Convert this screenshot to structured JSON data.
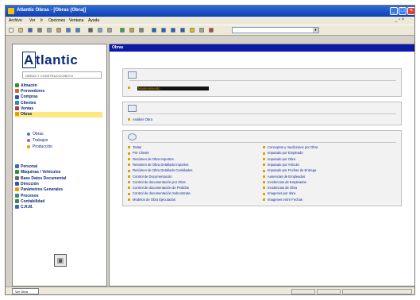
{
  "window": {
    "title": "Atlantic Obras - [Obras (Obra)]",
    "minimize_glyph": "_",
    "maximize_glyph": "□",
    "close_glyph": "×"
  },
  "menubar": {
    "items": [
      "Archivo",
      "Ver",
      "Ir",
      "Opciones",
      "Ventana",
      "Ayuda"
    ],
    "child_controls": "_ ▫ ×"
  },
  "toolbar": {
    "icons": [
      "new-doc-icon",
      "open-icon",
      "save-icon",
      "cut-icon",
      "copy-icon",
      "paste-icon",
      "undo-icon",
      "redo-icon",
      "print-icon",
      "preview-icon",
      "find-icon",
      "refresh-icon",
      "filter-icon",
      "sort-icon",
      "first-icon",
      "prev-icon",
      "next-icon",
      "last-icon",
      "help-icon",
      "zoom-icon",
      "exit-icon"
    ],
    "combo_value": "",
    "combo_arrow": "▼"
  },
  "sidebar": {
    "logo": "tlantic",
    "logo_initial": "A",
    "company_select": "OBRAS Y CONSTRUCCIONES ▾",
    "items_top": [
      {
        "label": "Almacén",
        "color": "#3a8a3a"
      },
      {
        "label": "Proveedores",
        "color": "#c07020"
      },
      {
        "label": "Compras",
        "color": "#2a5ab0"
      },
      {
        "label": "Clientes",
        "color": "#2a8ab0"
      },
      {
        "label": "Ventas",
        "color": "#b03a3a"
      },
      {
        "label": "Obras",
        "color": "#e0a000",
        "active": true
      }
    ],
    "sub_items": [
      {
        "label": "Obras",
        "color": "#4a7ad0"
      },
      {
        "label": "Trabajos",
        "color": "#c04ab0"
      },
      {
        "label": "Producción",
        "color": "#e0a000"
      }
    ],
    "items_bottom": [
      {
        "label": "Personal",
        "color": "#3a6ab0"
      },
      {
        "label": "Máquinas / Vehículos",
        "color": "#3a8a3a"
      },
      {
        "label": "Base Datos Documental",
        "color": "#6a6a6a"
      },
      {
        "label": "Dirección",
        "color": "#2a5ab0"
      },
      {
        "label": "Parámetros Generales",
        "color": "#e0a000"
      },
      {
        "label": "Procesos",
        "color": "#3a8a8a"
      },
      {
        "label": "Contabilidad",
        "color": "#3a8a3a"
      },
      {
        "label": "C.R.M.",
        "color": "#3a6ab0"
      }
    ],
    "bottom_logo_glyph": "▣"
  },
  "main": {
    "header": "Obras",
    "panel1": {
      "field_value": "Mantenimiento"
    },
    "panel2": {
      "link": "Análisis Obra"
    },
    "panel3": {
      "left_links": [
        "Todas",
        "Por Cliente",
        "Resúmen de Obra  Importes",
        "Resúmen de Obra Detallado  Importes",
        "Resúmen de Obra Detallado  Cantidades",
        "Control de Documentación",
        "Control de documentación por Obra",
        "Control de documentación de Pedidos",
        "Control de documentación Subcontrata",
        "Modelos de Obra Ejecutados"
      ],
      "right_links": [
        "Conceptos y mediciones por Obra",
        "Imputado por Empleado",
        "Imputado por Obra",
        "Imputado por Artículo",
        "Imputado por Fechas de Entrega",
        "Ausencias de Empleados",
        "Incidencias de Empleados",
        "Incidencias de Obra",
        "Imagenes por obra",
        "Imagenes entre Fechas"
      ]
    }
  },
  "statusbar": {
    "task_button": "Ver Obra",
    "cells": [
      "",
      "",
      ""
    ]
  }
}
